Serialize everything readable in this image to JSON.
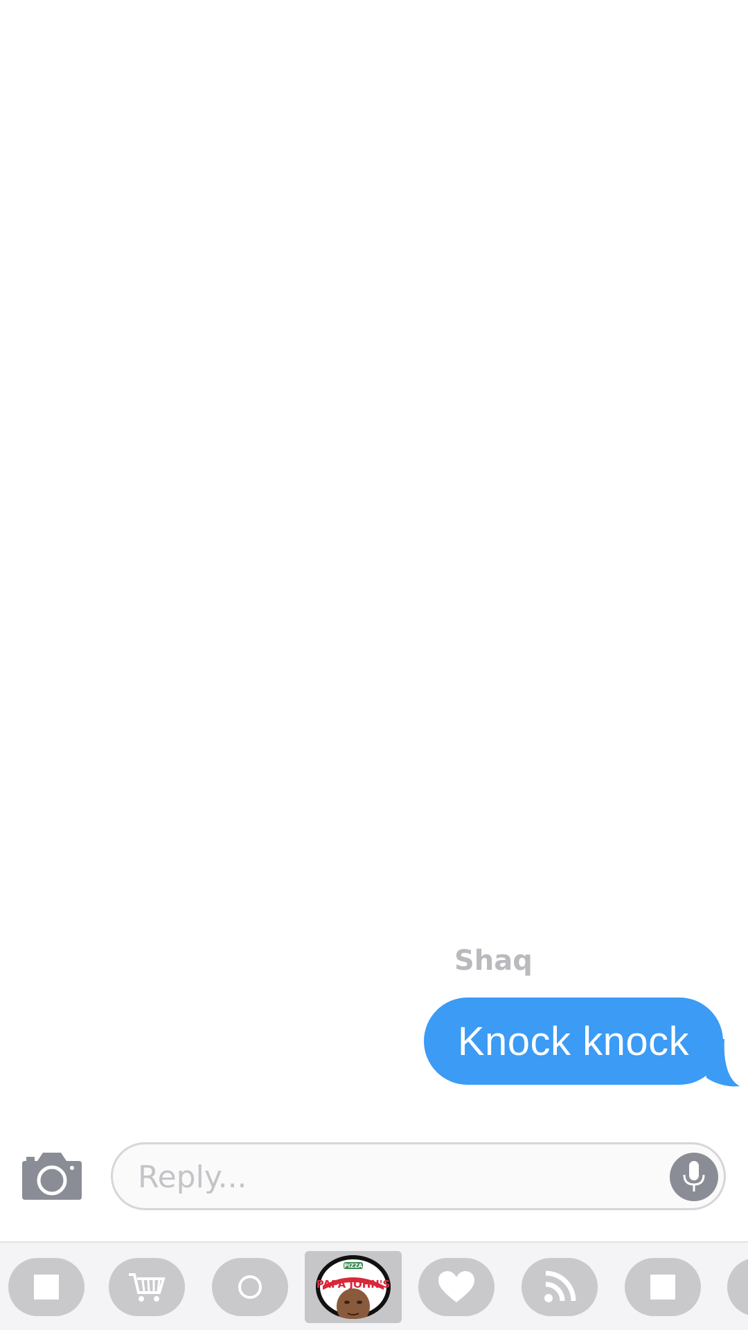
{
  "conversation": {
    "messages": [
      {
        "sender": "Shaq",
        "text": "Knock knock"
      }
    ]
  },
  "input": {
    "placeholder": "Reply..."
  },
  "colors": {
    "bubble": "#3b9bf5",
    "sender_name": "#b9b9be",
    "tray_background": "#f4f4f6",
    "tray_item": "#c9c9cc",
    "mic_button": "#8b8d96",
    "camera_icon": "#8b8d96"
  },
  "tray": {
    "apps": [
      {
        "icon": "square-icon"
      },
      {
        "icon": "shopping-cart-icon"
      },
      {
        "icon": "circle-icon"
      },
      {
        "icon": "papa-johns-shaq-sticker-icon",
        "selected": true,
        "logo_text": "PAPA JOHN'S",
        "logo_badge": "PIZZA"
      },
      {
        "icon": "heart-icon"
      },
      {
        "icon": "rss-icon"
      },
      {
        "icon": "square-icon"
      },
      {
        "icon": "partial-app-icon"
      }
    ]
  }
}
